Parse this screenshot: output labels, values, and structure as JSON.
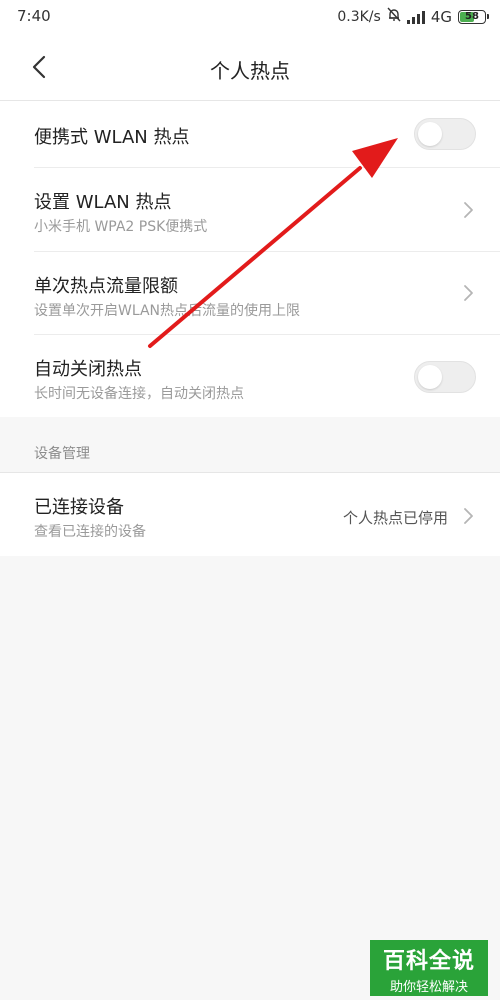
{
  "status_bar": {
    "time": "7:40",
    "net_speed": "0.3K/s",
    "network": "4G",
    "battery": "58"
  },
  "header": {
    "title": "个人热点"
  },
  "settings": [
    {
      "title": "便携式 WLAN 热点",
      "control": "switch",
      "on": false
    },
    {
      "title": "设置 WLAN 热点",
      "subtitle": "小米手机 WPA2 PSK便携式",
      "control": "chevron"
    },
    {
      "title": "单次热点流量限额",
      "subtitle": "设置单次开启WLAN热点后流量的使用上限",
      "control": "chevron"
    },
    {
      "title": "自动关闭热点",
      "subtitle": "长时间无设备连接，自动关闭热点",
      "control": "switch",
      "on": false
    }
  ],
  "device_section": {
    "header": "设备管理",
    "item": {
      "title": "已连接设备",
      "subtitle": "查看已连接的设备",
      "value": "个人热点已停用"
    }
  },
  "watermark": {
    "main": "百科全说",
    "sub": "助你轻松解决"
  },
  "colors": {
    "annotation_arrow": "#e21b1b",
    "watermark_bg": "#2aa339",
    "battery_fill": "#4caf50"
  }
}
